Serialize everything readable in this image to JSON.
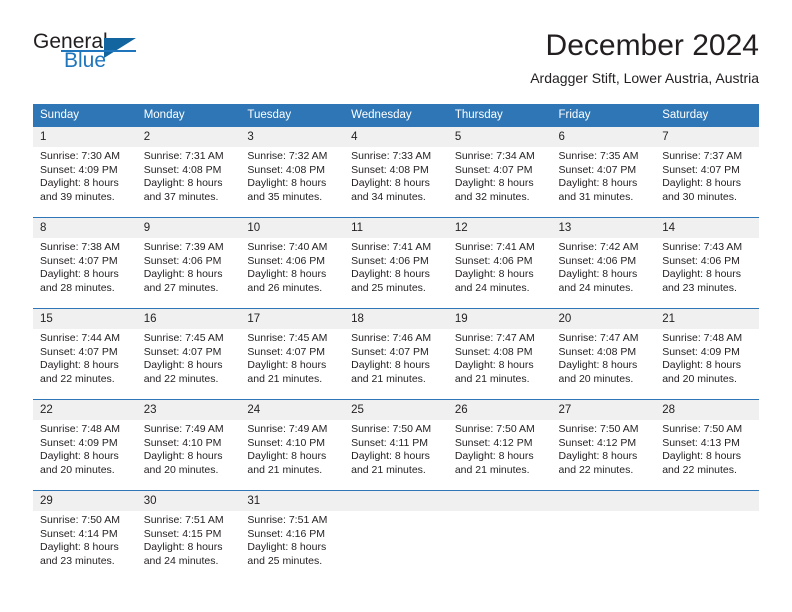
{
  "brand": {
    "word_one": "General",
    "word_two": "Blue",
    "accent_color": "#1f76bc",
    "triangle_color": "#12659f"
  },
  "header": {
    "title": "December 2024",
    "subtitle": "Ardagger Stift, Lower Austria, Austria"
  },
  "theme": {
    "header_row_bg": "#2e76b6",
    "daynum_bg": "#f0f0f0",
    "text_color": "#231f20"
  },
  "columns": [
    "Sunday",
    "Monday",
    "Tuesday",
    "Wednesday",
    "Thursday",
    "Friday",
    "Saturday"
  ],
  "weeks": [
    [
      {
        "day": "1",
        "sunrise": "Sunrise: 7:30 AM",
        "sunset": "Sunset: 4:09 PM",
        "daylight_line1": "Daylight: 8 hours",
        "daylight_line2": "and 39 minutes."
      },
      {
        "day": "2",
        "sunrise": "Sunrise: 7:31 AM",
        "sunset": "Sunset: 4:08 PM",
        "daylight_line1": "Daylight: 8 hours",
        "daylight_line2": "and 37 minutes."
      },
      {
        "day": "3",
        "sunrise": "Sunrise: 7:32 AM",
        "sunset": "Sunset: 4:08 PM",
        "daylight_line1": "Daylight: 8 hours",
        "daylight_line2": "and 35 minutes."
      },
      {
        "day": "4",
        "sunrise": "Sunrise: 7:33 AM",
        "sunset": "Sunset: 4:08 PM",
        "daylight_line1": "Daylight: 8 hours",
        "daylight_line2": "and 34 minutes."
      },
      {
        "day": "5",
        "sunrise": "Sunrise: 7:34 AM",
        "sunset": "Sunset: 4:07 PM",
        "daylight_line1": "Daylight: 8 hours",
        "daylight_line2": "and 32 minutes."
      },
      {
        "day": "6",
        "sunrise": "Sunrise: 7:35 AM",
        "sunset": "Sunset: 4:07 PM",
        "daylight_line1": "Daylight: 8 hours",
        "daylight_line2": "and 31 minutes."
      },
      {
        "day": "7",
        "sunrise": "Sunrise: 7:37 AM",
        "sunset": "Sunset: 4:07 PM",
        "daylight_line1": "Daylight: 8 hours",
        "daylight_line2": "and 30 minutes."
      }
    ],
    [
      {
        "day": "8",
        "sunrise": "Sunrise: 7:38 AM",
        "sunset": "Sunset: 4:07 PM",
        "daylight_line1": "Daylight: 8 hours",
        "daylight_line2": "and 28 minutes."
      },
      {
        "day": "9",
        "sunrise": "Sunrise: 7:39 AM",
        "sunset": "Sunset: 4:06 PM",
        "daylight_line1": "Daylight: 8 hours",
        "daylight_line2": "and 27 minutes."
      },
      {
        "day": "10",
        "sunrise": "Sunrise: 7:40 AM",
        "sunset": "Sunset: 4:06 PM",
        "daylight_line1": "Daylight: 8 hours",
        "daylight_line2": "and 26 minutes."
      },
      {
        "day": "11",
        "sunrise": "Sunrise: 7:41 AM",
        "sunset": "Sunset: 4:06 PM",
        "daylight_line1": "Daylight: 8 hours",
        "daylight_line2": "and 25 minutes."
      },
      {
        "day": "12",
        "sunrise": "Sunrise: 7:41 AM",
        "sunset": "Sunset: 4:06 PM",
        "daylight_line1": "Daylight: 8 hours",
        "daylight_line2": "and 24 minutes."
      },
      {
        "day": "13",
        "sunrise": "Sunrise: 7:42 AM",
        "sunset": "Sunset: 4:06 PM",
        "daylight_line1": "Daylight: 8 hours",
        "daylight_line2": "and 24 minutes."
      },
      {
        "day": "14",
        "sunrise": "Sunrise: 7:43 AM",
        "sunset": "Sunset: 4:06 PM",
        "daylight_line1": "Daylight: 8 hours",
        "daylight_line2": "and 23 minutes."
      }
    ],
    [
      {
        "day": "15",
        "sunrise": "Sunrise: 7:44 AM",
        "sunset": "Sunset: 4:07 PM",
        "daylight_line1": "Daylight: 8 hours",
        "daylight_line2": "and 22 minutes."
      },
      {
        "day": "16",
        "sunrise": "Sunrise: 7:45 AM",
        "sunset": "Sunset: 4:07 PM",
        "daylight_line1": "Daylight: 8 hours",
        "daylight_line2": "and 22 minutes."
      },
      {
        "day": "17",
        "sunrise": "Sunrise: 7:45 AM",
        "sunset": "Sunset: 4:07 PM",
        "daylight_line1": "Daylight: 8 hours",
        "daylight_line2": "and 21 minutes."
      },
      {
        "day": "18",
        "sunrise": "Sunrise: 7:46 AM",
        "sunset": "Sunset: 4:07 PM",
        "daylight_line1": "Daylight: 8 hours",
        "daylight_line2": "and 21 minutes."
      },
      {
        "day": "19",
        "sunrise": "Sunrise: 7:47 AM",
        "sunset": "Sunset: 4:08 PM",
        "daylight_line1": "Daylight: 8 hours",
        "daylight_line2": "and 21 minutes."
      },
      {
        "day": "20",
        "sunrise": "Sunrise: 7:47 AM",
        "sunset": "Sunset: 4:08 PM",
        "daylight_line1": "Daylight: 8 hours",
        "daylight_line2": "and 20 minutes."
      },
      {
        "day": "21",
        "sunrise": "Sunrise: 7:48 AM",
        "sunset": "Sunset: 4:09 PM",
        "daylight_line1": "Daylight: 8 hours",
        "daylight_line2": "and 20 minutes."
      }
    ],
    [
      {
        "day": "22",
        "sunrise": "Sunrise: 7:48 AM",
        "sunset": "Sunset: 4:09 PM",
        "daylight_line1": "Daylight: 8 hours",
        "daylight_line2": "and 20 minutes."
      },
      {
        "day": "23",
        "sunrise": "Sunrise: 7:49 AM",
        "sunset": "Sunset: 4:10 PM",
        "daylight_line1": "Daylight: 8 hours",
        "daylight_line2": "and 20 minutes."
      },
      {
        "day": "24",
        "sunrise": "Sunrise: 7:49 AM",
        "sunset": "Sunset: 4:10 PM",
        "daylight_line1": "Daylight: 8 hours",
        "daylight_line2": "and 21 minutes."
      },
      {
        "day": "25",
        "sunrise": "Sunrise: 7:50 AM",
        "sunset": "Sunset: 4:11 PM",
        "daylight_line1": "Daylight: 8 hours",
        "daylight_line2": "and 21 minutes."
      },
      {
        "day": "26",
        "sunrise": "Sunrise: 7:50 AM",
        "sunset": "Sunset: 4:12 PM",
        "daylight_line1": "Daylight: 8 hours",
        "daylight_line2": "and 21 minutes."
      },
      {
        "day": "27",
        "sunrise": "Sunrise: 7:50 AM",
        "sunset": "Sunset: 4:12 PM",
        "daylight_line1": "Daylight: 8 hours",
        "daylight_line2": "and 22 minutes."
      },
      {
        "day": "28",
        "sunrise": "Sunrise: 7:50 AM",
        "sunset": "Sunset: 4:13 PM",
        "daylight_line1": "Daylight: 8 hours",
        "daylight_line2": "and 22 minutes."
      }
    ],
    [
      {
        "day": "29",
        "sunrise": "Sunrise: 7:50 AM",
        "sunset": "Sunset: 4:14 PM",
        "daylight_line1": "Daylight: 8 hours",
        "daylight_line2": "and 23 minutes."
      },
      {
        "day": "30",
        "sunrise": "Sunrise: 7:51 AM",
        "sunset": "Sunset: 4:15 PM",
        "daylight_line1": "Daylight: 8 hours",
        "daylight_line2": "and 24 minutes."
      },
      {
        "day": "31",
        "sunrise": "Sunrise: 7:51 AM",
        "sunset": "Sunset: 4:16 PM",
        "daylight_line1": "Daylight: 8 hours",
        "daylight_line2": "and 25 minutes."
      },
      {
        "day": "",
        "sunrise": "",
        "sunset": "",
        "daylight_line1": "",
        "daylight_line2": ""
      },
      {
        "day": "",
        "sunrise": "",
        "sunset": "",
        "daylight_line1": "",
        "daylight_line2": ""
      },
      {
        "day": "",
        "sunrise": "",
        "sunset": "",
        "daylight_line1": "",
        "daylight_line2": ""
      },
      {
        "day": "",
        "sunrise": "",
        "sunset": "",
        "daylight_line1": "",
        "daylight_line2": ""
      }
    ]
  ]
}
